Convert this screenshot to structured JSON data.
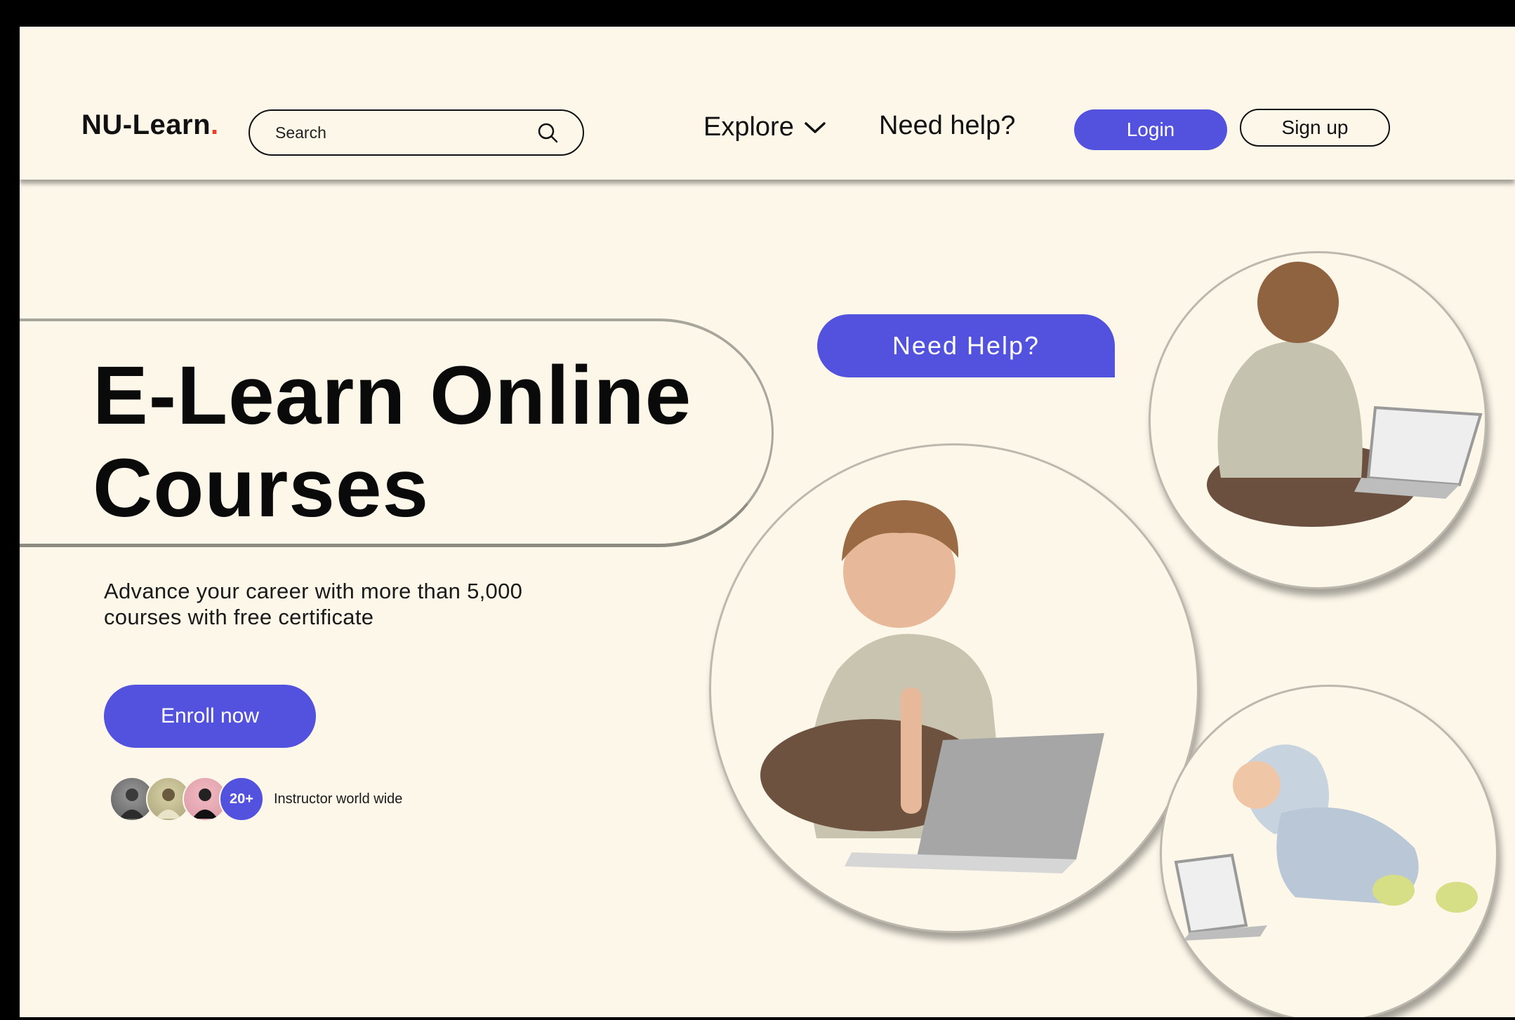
{
  "header": {
    "logo_text": "NU-Learn",
    "logo_dot": ".",
    "search_placeholder": "Search",
    "nav_explore": "Explore",
    "nav_help": "Need help?",
    "login_label": "Login",
    "signup_label": "Sign up"
  },
  "hero": {
    "title_line1": "E-Learn Online",
    "title_line2": "Courses",
    "subtitle_line1": "Advance your career with more than 5,000",
    "subtitle_line2": "courses with free certificate",
    "enroll_label": "Enroll now",
    "need_help_chip": "Need Help?",
    "instructor_count": "20+",
    "instructor_label": "Instructor world wide"
  },
  "colors": {
    "accent": "#5352de",
    "background": "#fdf7ea",
    "logo_dot": "#e8402a"
  },
  "icons": {
    "search": "search-icon",
    "dropdown": "chevron-down-icon"
  }
}
